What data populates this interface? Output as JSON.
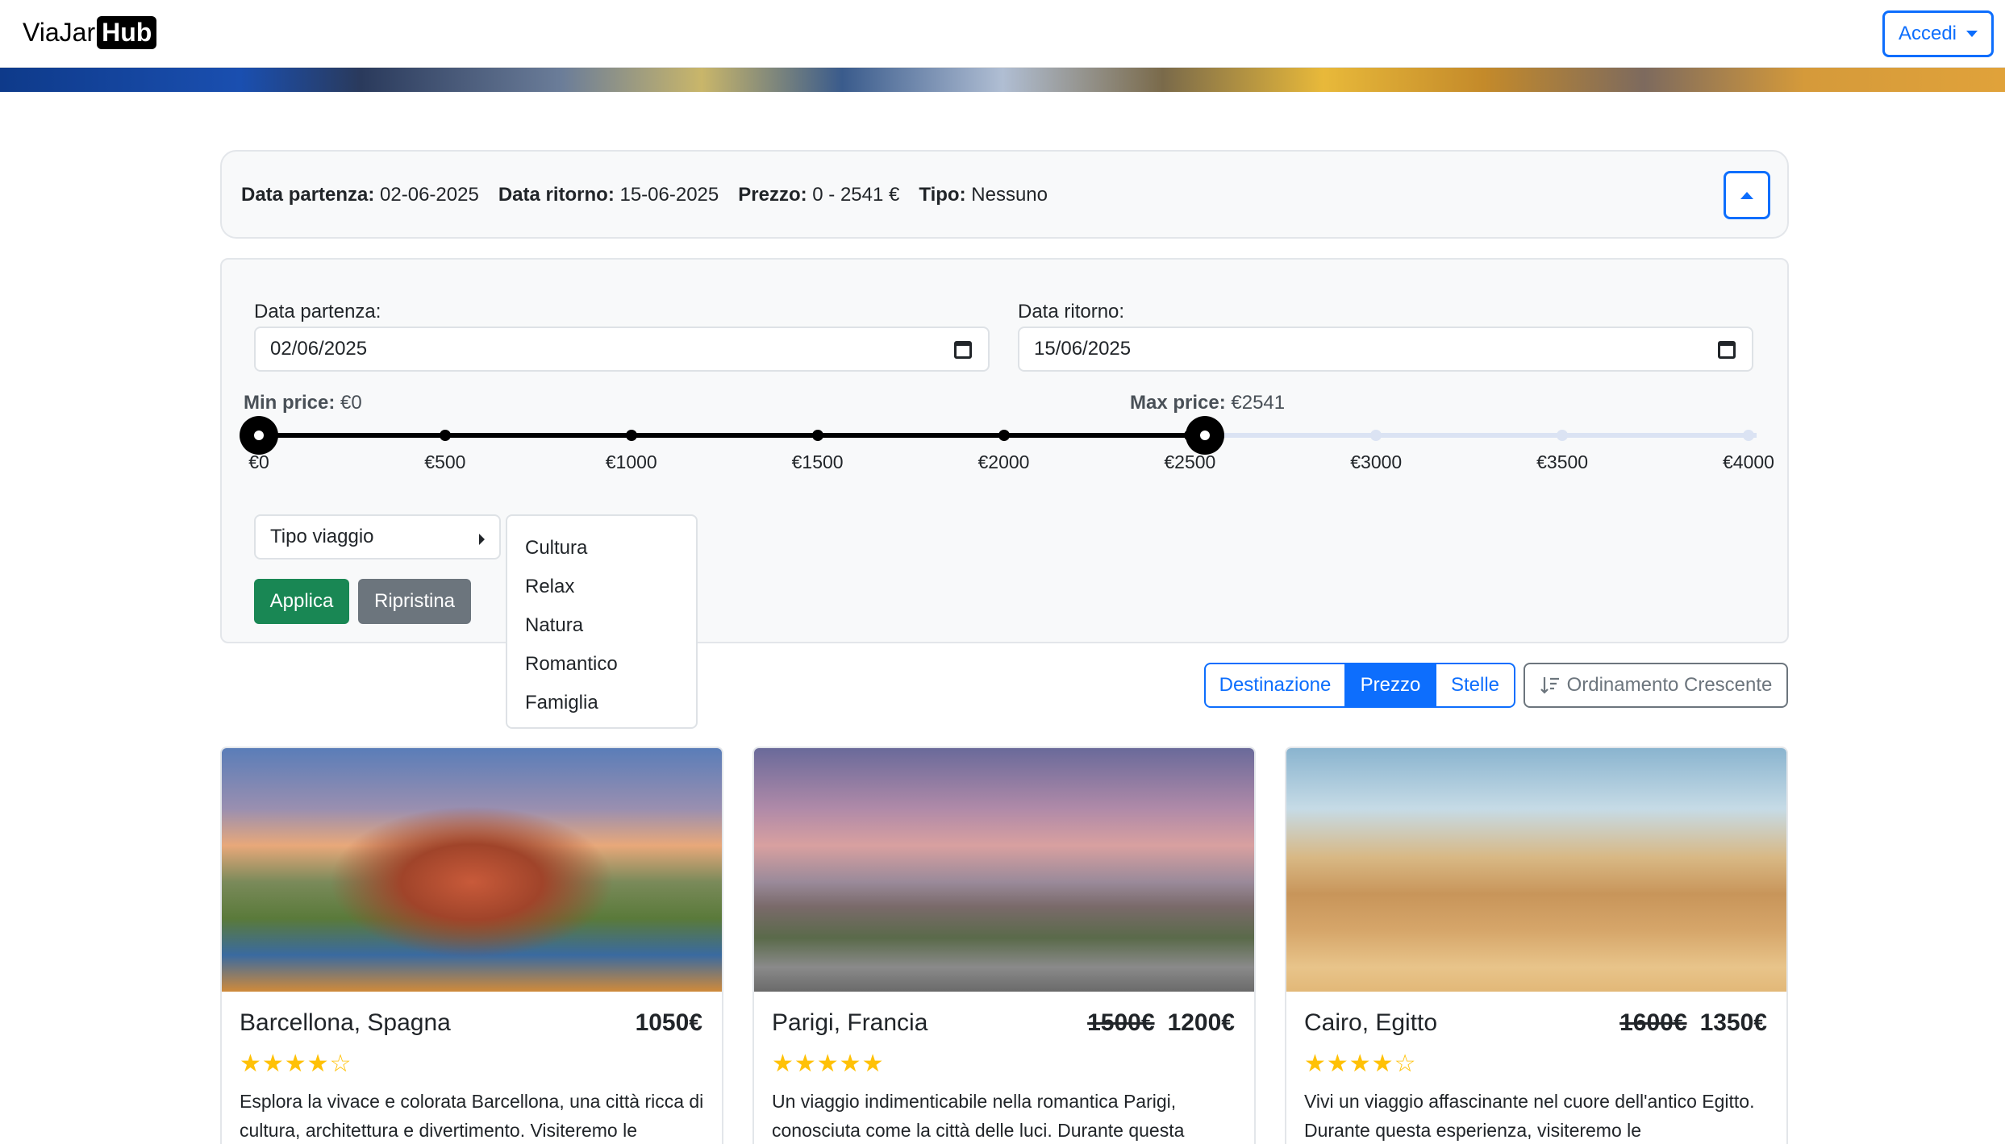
{
  "nav": {
    "brand_text": "ViaJar",
    "brand_badge": "Hub",
    "login_label": "Accedi"
  },
  "summary": {
    "departure_label": "Data partenza:",
    "departure_value": "02-06-2025",
    "return_label": "Data ritorno:",
    "return_value": "15-06-2025",
    "price_label": "Prezzo:",
    "price_value": "0 - 2541 €",
    "type_label": "Tipo:",
    "type_value": "Nessuno"
  },
  "filters": {
    "departure_label": "Data partenza:",
    "departure_value": "02/06/2025",
    "return_label": "Data ritorno:",
    "return_value": "15/06/2025",
    "min_price_label": "Min price:",
    "min_price_value": "€0",
    "max_price_label": "Max price:",
    "max_price_value": "€2541",
    "slider": {
      "range_min": 0,
      "range_max": 4000,
      "selected_min": 0,
      "selected_max": 2541,
      "ticks": [
        "€0",
        "€500",
        "€1000",
        "€1500",
        "€2000",
        "€2500",
        "€3000",
        "€3500",
        "€4000"
      ]
    },
    "type_dropdown_label": "Tipo viaggio",
    "type_options": [
      "Cultura",
      "Relax",
      "Natura",
      "Romantico",
      "Famiglia"
    ],
    "apply_label": "Applica",
    "reset_label": "Ripristina"
  },
  "sort": {
    "options": [
      "Destinazione",
      "Prezzo",
      "Stelle"
    ],
    "active": "Prezzo",
    "order_label": "Ordinamento Crescente"
  },
  "cards": [
    {
      "title": "Barcellona, Spagna",
      "old_price": "",
      "price": "1050€",
      "rating": 4,
      "stars": "★★★★☆",
      "description": "Esplora la vivace e colorata Barcellona, una città ricca di cultura, architettura e divertimento. Visiteremo le"
    },
    {
      "title": "Parigi, Francia",
      "old_price": "1500€",
      "price": "1200€",
      "rating": 5,
      "stars": "★★★★★",
      "description": "Un viaggio indimenticabile nella romantica Parigi, conosciuta come la città delle luci. Durante questa"
    },
    {
      "title": "Cairo, Egitto",
      "old_price": "1600€",
      "price": "1350€",
      "rating": 4,
      "stars": "★★★★☆",
      "description": "Vivi un viaggio affascinante nel cuore dell'antico Egitto. Durante questa esperienza, visiteremo le"
    }
  ]
}
